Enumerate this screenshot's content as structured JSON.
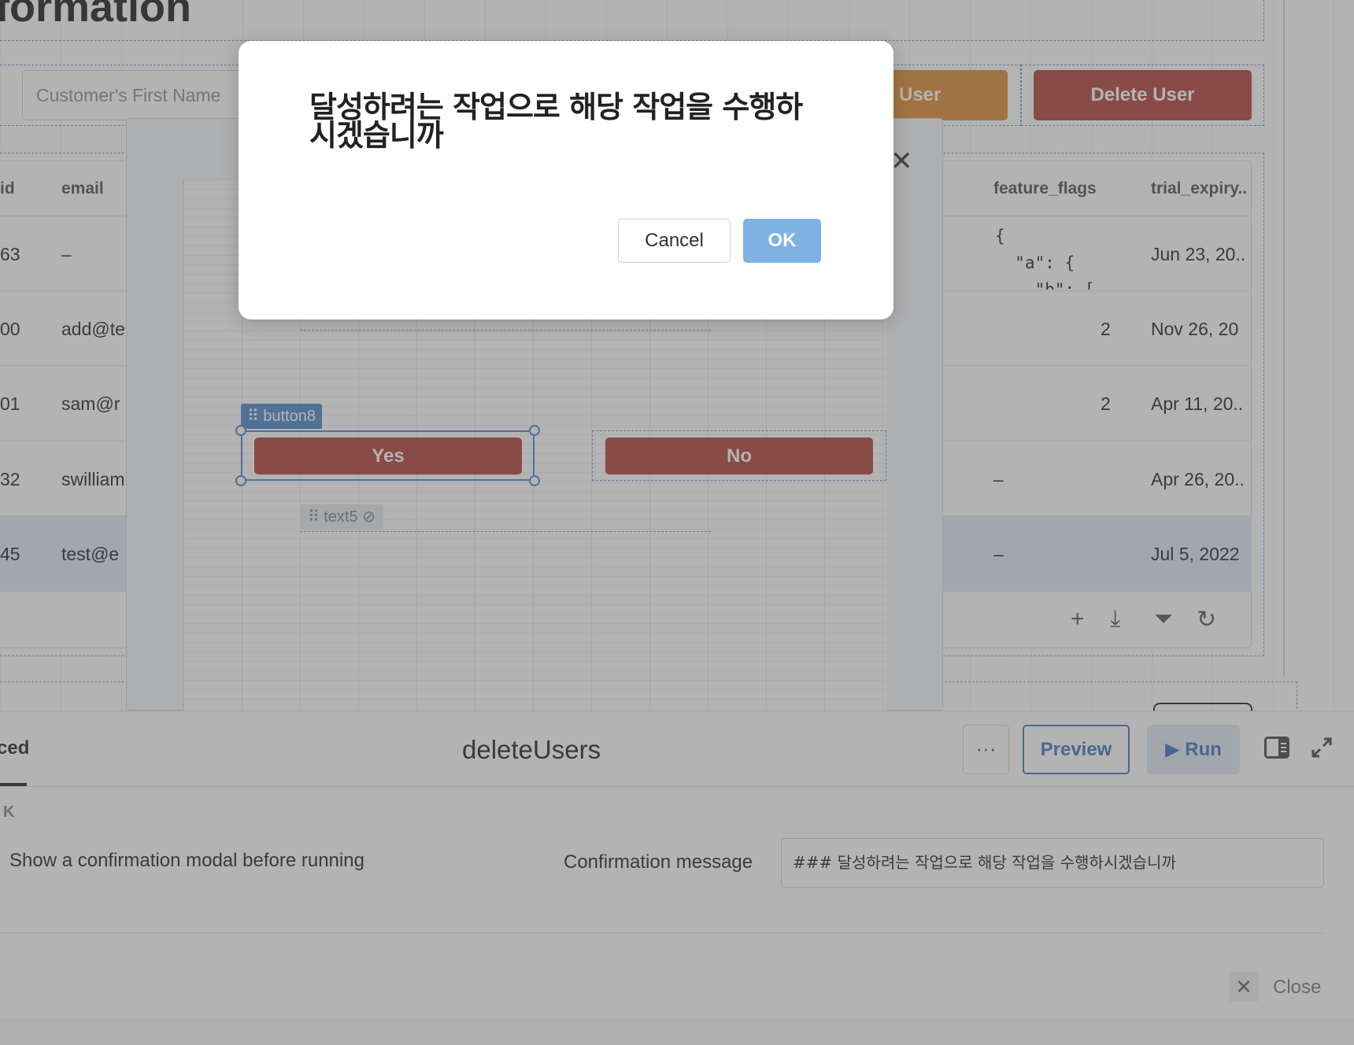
{
  "app": {
    "page_title": "formation"
  },
  "toolbar": {
    "search_placeholder": "Customer's First Name",
    "update_user_label": "User",
    "delete_user_label": "Delete User"
  },
  "table": {
    "headers": {
      "id": "id",
      "email": "email",
      "feature_flags": "feature_flags",
      "trial_expiry": "trial_expiry.."
    },
    "rows": [
      {
        "id": "63",
        "email": "–",
        "feature_flags_lines": [
          "{",
          "  \"a\": {",
          "    \"b\": ["
        ],
        "trial_expiry": "Jun 23, 20.."
      },
      {
        "id": "00",
        "email": "add@te",
        "feature_flags": "2",
        "trial_expiry": "Nov 26, 20"
      },
      {
        "id": "01",
        "email": "sam@r",
        "feature_flags": "2",
        "trial_expiry": "Apr 11, 20.."
      },
      {
        "id": "32",
        "email": "swilliam",
        "feature_flags": "–",
        "trial_expiry": "Apr 26, 20.."
      },
      {
        "id": "45",
        "email": "test@e",
        "feature_flags": "–",
        "trial_expiry": "Jul 5, 2022"
      }
    ],
    "tools": {
      "add": "+",
      "download": "⤓",
      "filter": "⏷",
      "refresh": "↻"
    }
  },
  "builder": {
    "close_glyph": "✕",
    "selected_component_tag": "button8",
    "hidden_component_tag": "text5",
    "yes_label": "Yes",
    "no_label": "No"
  },
  "panel": {
    "active_tab": "ced",
    "query_name": "deleteUsers",
    "more_glyph": "···",
    "preview_label": "Preview",
    "run_label": "Run",
    "section_label": "K",
    "confirm_option_label": "Show a confirmation modal before running",
    "message_label": "Confirmation message",
    "message_value": "### 달성하려는 작업으로 해당 작업을 수행하시겠습니까",
    "close_label": "Close",
    "close_glyph": "✕"
  },
  "dialog": {
    "message": "달성하려는 작업으로 해당 작업을 수행하시겠습니까",
    "cancel_label": "Cancel",
    "ok_label": "OK"
  },
  "colors": {
    "accent": "#3d74c0",
    "danger": "#b1403a",
    "warning": "#e0892f",
    "ok_button": "#7fb1e3"
  }
}
